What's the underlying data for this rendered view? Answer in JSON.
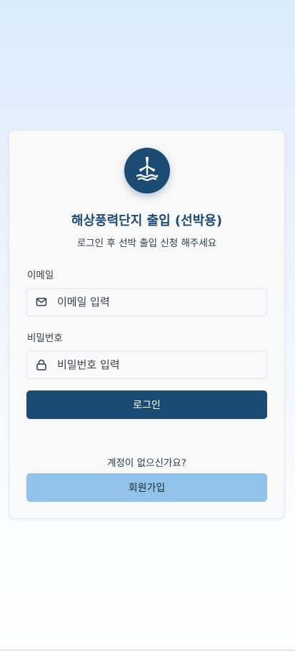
{
  "login": {
    "title": "해상풍력단지 출입 (선박용)",
    "subtitle": "로그인 후 선박 출입 신청 해주세요",
    "email_label": "이메일",
    "email_placeholder": "이메일 입력",
    "email_value": "",
    "password_label": "비밀번호",
    "password_placeholder": "비밀번호 입력",
    "password_value": "",
    "login_button": "로그인",
    "signup_prompt": "계정이 없으신가요?",
    "signup_button": "회원가입"
  },
  "icons": {
    "logo": "wind-turbine-icon",
    "email": "mail-icon",
    "password": "lock-icon"
  },
  "colors": {
    "primary": "#1b4b72",
    "secondary": "#92c3ea",
    "card": "#f9f9f9"
  }
}
